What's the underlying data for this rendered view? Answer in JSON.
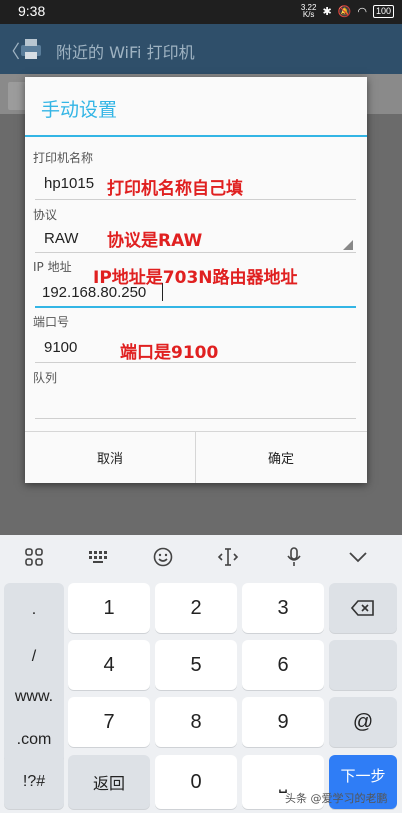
{
  "status_bar": {
    "time": "9:38",
    "net_speed_value": "3.22",
    "net_speed_unit": "K/s",
    "battery": "100"
  },
  "app_bar": {
    "back_glyph": "〈",
    "title": "附近的 WiFi 打印机"
  },
  "dialog": {
    "title": "手动设置",
    "fields": [
      {
        "label": "打印机名称",
        "value": "hp1015",
        "annotation": "打印机名称自己填"
      },
      {
        "label": "协议",
        "value": "RAW",
        "annotation": "协议是RAW"
      },
      {
        "label": "IP 地址",
        "value": "192.168.80.250",
        "annotation": "IP地址是703N路由器地址"
      },
      {
        "label": "端口号",
        "value": "9100",
        "annotation": "端口是9100"
      },
      {
        "label": "队列",
        "value": ""
      }
    ],
    "cancel_label": "取消",
    "ok_label": "确定"
  },
  "keyboard": {
    "toolbar_icons": [
      "grid-icon",
      "keyboard-icon",
      "emoji-icon",
      "cursor-icon",
      "mic-icon",
      "chevron-down-icon"
    ],
    "left_keys": [
      ".",
      "/",
      "www.",
      ".com",
      "!?#"
    ],
    "digits": [
      "1",
      "2",
      "3",
      "4",
      "5",
      "6",
      "7",
      "8",
      "9"
    ],
    "zero": "0",
    "back_label": "返回",
    "space_glyph": "⎵",
    "at": "@",
    "next_label": "下一步",
    "accent_color": "#2f7df6"
  },
  "watermark": "头条 @爱学习的老鹏"
}
